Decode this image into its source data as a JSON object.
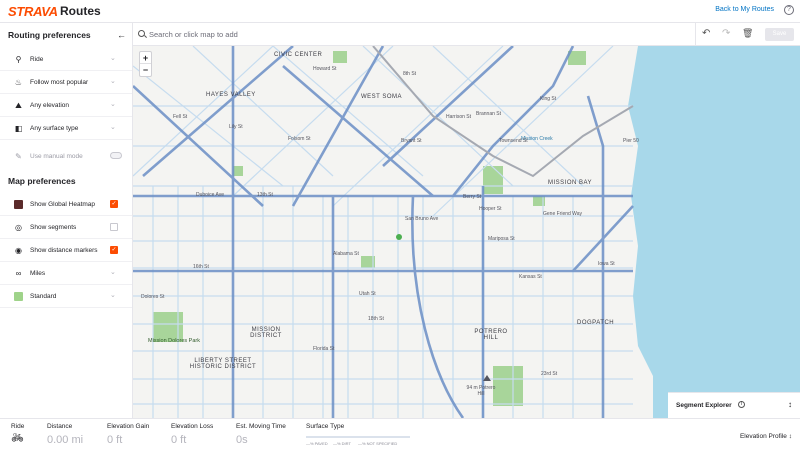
{
  "header": {
    "logo": "STRAVA",
    "app_title": "Routes",
    "back_link": "Back to My Routes",
    "help_icon": "?"
  },
  "sidebar": {
    "routing_title": "Routing preferences",
    "routing_items": [
      {
        "label": "Ride",
        "icon": "bike-icon",
        "glyph": "⚲"
      },
      {
        "label": "Follow most popular",
        "icon": "popularity-icon",
        "glyph": "♨"
      },
      {
        "label": "Any elevation",
        "icon": "elevation-icon",
        "glyph": "⛰"
      },
      {
        "label": "Any surface type",
        "icon": "surface-icon",
        "glyph": "◧"
      }
    ],
    "manual_mode_label": "Use manual mode",
    "map_title": "Map preferences",
    "map_items": [
      {
        "label": "Show Global Heatmap",
        "checked": true
      },
      {
        "label": "Show segments",
        "checked": false
      },
      {
        "label": "Show distance markers",
        "checked": true
      },
      {
        "label": "Miles"
      },
      {
        "label": "Standard"
      }
    ]
  },
  "search": {
    "placeholder": "Search or click map to add"
  },
  "toolbar": {
    "save_label": "Save",
    "undo_glyph": "↶",
    "redo_glyph": "↷",
    "delete_glyph": "🗑"
  },
  "map": {
    "zoom_in": "+",
    "zoom_out": "−",
    "neighborhoods": [
      "CIVIC CENTER",
      "HAYES VALLEY",
      "WEST SOMA",
      "MISSION BAY",
      "MISSION DISTRICT",
      "LIBERTY STREET HISTORIC DISTRICT",
      "POTRERO HILL",
      "DOGPATCH"
    ],
    "streets": [
      "Fell St",
      "Lily St",
      "Duboice Ave",
      "13th St",
      "16th St",
      "18th St",
      "Folsom St",
      "Bryant St",
      "King St",
      "Mission Creek",
      "Pier 50",
      "Gene Friend Way",
      "Alabama St",
      "Utah St",
      "Kansas St",
      "Florida St",
      "23rd St",
      "Iowa St",
      "Dolores St",
      "Howard St",
      "Harrison St",
      "Brannan St",
      "Townsend St",
      "Berry St",
      "Hooper St",
      "Mariposa St",
      "San Bruno Ave",
      "94 m Potrero Hill",
      "8th St"
    ],
    "parks": [
      "Mission Dolores Park"
    ],
    "segment_explorer": "Segment Explorer"
  },
  "stats": {
    "activity": {
      "label": "Ride"
    },
    "distance": {
      "label": "Distance",
      "value": "0.00 mi"
    },
    "elevation_gain": {
      "label": "Elevation Gain",
      "value": "0 ft"
    },
    "elevation_loss": {
      "label": "Elevation Loss",
      "value": "0 ft"
    },
    "moving_time": {
      "label": "Est. Moving Time",
      "value": "0s"
    },
    "surface": {
      "label": "Surface Type",
      "legend": [
        "—% PAVED",
        "—% DIRT",
        "—% NOT SPECIFIED"
      ]
    },
    "elevation_profile": "Elevation Profile"
  }
}
